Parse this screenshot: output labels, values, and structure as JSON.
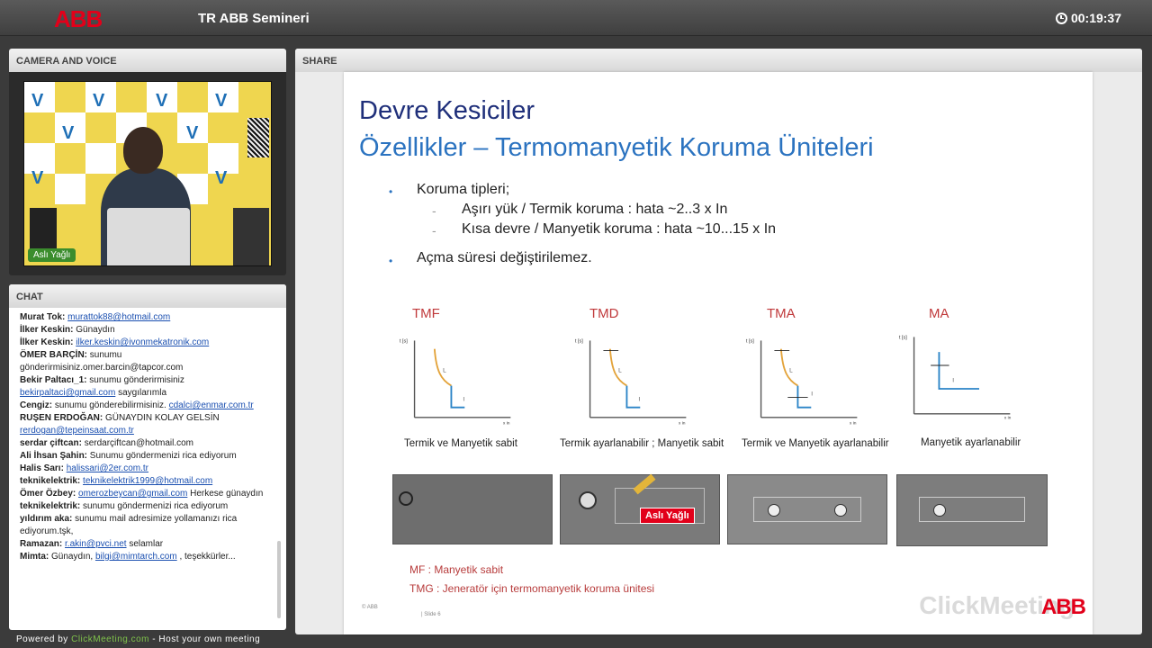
{
  "header": {
    "logo": "ABB",
    "title": "TR ABB Semineri",
    "timer": "00:19:37"
  },
  "camera": {
    "panel_title": "CAMERA AND VOICE",
    "presenter": "Aslı Yağlı"
  },
  "chat": {
    "panel_title": "CHAT",
    "messages": [
      {
        "author": "Murat Tok:",
        "text": "",
        "link": "murattok88@hotmail.com",
        "after": ""
      },
      {
        "author": "İlker Keskin:",
        "text": "Günaydın",
        "link": "",
        "after": ""
      },
      {
        "author": "İlker Keskin:",
        "text": "",
        "link": "ilker.keskin@ivonmekatronik.com",
        "after": ""
      },
      {
        "author": "ÖMER BARÇİN:",
        "text": "sunumu gönderirmisiniz.omer.barcin@tapcor.com",
        "link": "",
        "after": ""
      },
      {
        "author": "Bekir Paltacı_1:",
        "text": "sunumu gönderirmisiniz",
        "link": "bekirpaltaci@gmail.com",
        "after": "saygılarımla"
      },
      {
        "author": "Cengiz:",
        "text": "sunumu gönderebilirmisiniz.",
        "link": "cdalci@enmar.com.tr",
        "after": ""
      },
      {
        "author": "RUŞEN ERDOĞAN:",
        "text": "GÜNAYDIN KOLAY GELSİN",
        "link": "rerdogan@tepeinsaat.com.tr",
        "after": ""
      },
      {
        "author": "serdar çiftcan:",
        "text": "serdarçiftcan@hotmail.com",
        "link": "",
        "after": ""
      },
      {
        "author": "Ali İhsan Şahin:",
        "text": "Sunumu göndermenizi rica ediyorum",
        "link": "",
        "after": ""
      },
      {
        "author": "Halis Sarı:",
        "text": "",
        "link": "halissari@2er.com.tr",
        "after": ""
      },
      {
        "author": "teknikelektrik:",
        "text": "",
        "link": "teknikelektrik1999@hotmail.com",
        "after": ""
      },
      {
        "author": "Ömer Özbey:",
        "text": "",
        "link": "omerozbeycan@gmail.com",
        "after": "Herkese günaydın"
      },
      {
        "author": "teknikelektrik:",
        "text": "sunumu göndermenizi rica ediyorum",
        "link": "",
        "after": ""
      },
      {
        "author": "yıldırım aka:",
        "text": "sunumu mail adresimize yollamanızı rica ediyorum.tşk,",
        "link": "",
        "after": ""
      },
      {
        "author": "Ramazan:",
        "text": "",
        "link": "r.akin@pvci.net",
        "after": "selamlar"
      },
      {
        "author": "Mimta:",
        "text": "Günaydın,",
        "link": "bilgi@mimtarch.com",
        "after": ", teşekkürler..."
      }
    ]
  },
  "footer": {
    "prefix": "Powered by",
    "brand": "ClickMeeting.com",
    "suffix": "- Host your own meeting"
  },
  "share": {
    "panel_title": "SHARE",
    "slide": {
      "title1": "Devre Kesiciler",
      "title2": "Özellikler – Termomanyetik Koruma Üniteleri",
      "bullet1": "Koruma tipleri;",
      "sub1": "Aşırı yük / Termik koruma   : hata ~2..3 x In",
      "sub2": "Kısa devre / Manyetik koruma   : hata ~10...15 x In",
      "bullet2": "Açma süresi değiştirilemez.",
      "curves": [
        {
          "title": "TMF",
          "caption": "Termik ve Manyetik sabit"
        },
        {
          "title": "TMD",
          "caption": "Termik ayarlanabilir ; Manyetik sabit"
        },
        {
          "title": "TMA",
          "caption": "Termik ve Manyetik ayarlanabilir"
        },
        {
          "title": "MA",
          "caption": "Manyetik ayarlanabilir"
        }
      ],
      "axis_y": "t [s]",
      "axis_x": "x In",
      "curve_label_l": "L",
      "curve_label_i": "I",
      "presenter_tag": "Aslı Yağlı",
      "note1": "MF     : Manyetik sabit",
      "note2": "TMG : Jeneratör için termomanyetik koruma ünitesi",
      "foot_left": "© ABB",
      "foot_mid": "| Slide 6",
      "logo": "ABB",
      "watermark": "ClickMeeting"
    }
  }
}
